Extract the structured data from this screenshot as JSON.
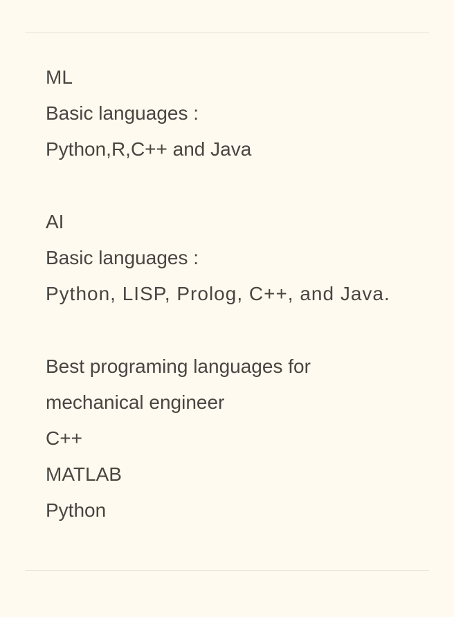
{
  "note": {
    "sections": [
      {
        "heading": "ML",
        "label": "Basic languages :",
        "languages": "Python,R,C++ and Java"
      },
      {
        "heading": "AI",
        "label": "Basic languages :",
        "languages": "Python, LISP, Prolog, C++, and Java."
      },
      {
        "heading_line1": "Best programing languages for",
        "heading_line2": "mechanical engineer",
        "items": [
          "C++",
          "MATLAB",
          "Python"
        ]
      }
    ]
  }
}
